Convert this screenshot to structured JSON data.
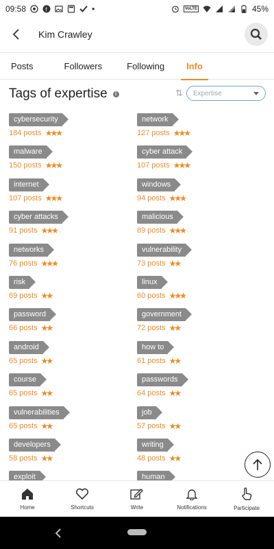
{
  "status_bar": {
    "time": "09:58",
    "dot": "•",
    "battery": "45%",
    "volte": "VoLTE"
  },
  "app_bar": {
    "title": "Kim Crawley"
  },
  "tabs": [
    {
      "label": "Posts"
    },
    {
      "label": "Followers"
    },
    {
      "label": "Following"
    },
    {
      "label": "Info",
      "active": true
    }
  ],
  "section": {
    "title": "Tags of expertise",
    "info": "i",
    "sort_glyph": "⇅",
    "select_value": "Expertise"
  },
  "tags_left": [
    {
      "name": "cybersecurity",
      "posts": "184 posts",
      "stars": "★★★"
    },
    {
      "name": "malware",
      "posts": "150 posts",
      "stars": "★★★"
    },
    {
      "name": "internet",
      "posts": "107 posts",
      "stars": "★★★"
    },
    {
      "name": "cyber attacks",
      "posts": "91 posts",
      "stars": "★★★"
    },
    {
      "name": "networks",
      "posts": "76 posts",
      "stars": "★★★"
    },
    {
      "name": "risk",
      "posts": "69 posts",
      "stars": "★★"
    },
    {
      "name": "password",
      "posts": "66 posts",
      "stars": "★★"
    },
    {
      "name": "android",
      "posts": "65 posts",
      "stars": "★★"
    },
    {
      "name": "course",
      "posts": "65 posts",
      "stars": "★★"
    },
    {
      "name": "vulnerabilities",
      "posts": "65 posts",
      "stars": "★★"
    },
    {
      "name": "developers",
      "posts": "58 posts",
      "stars": "★★"
    },
    {
      "name": "exploit",
      "posts": "",
      "stars": ""
    }
  ],
  "tags_right": [
    {
      "name": "network",
      "posts": "127 posts",
      "stars": "★★★"
    },
    {
      "name": "cyber attack",
      "posts": "107 posts",
      "stars": "★★★"
    },
    {
      "name": "windows",
      "posts": "94 posts",
      "stars": "★★★"
    },
    {
      "name": "malicious",
      "posts": "89 posts",
      "stars": "★★★"
    },
    {
      "name": "vulnerability",
      "posts": "73 posts",
      "stars": "★★"
    },
    {
      "name": "linux",
      "posts": "60 posts",
      "stars": "★★★"
    },
    {
      "name": "government",
      "posts": "72 posts",
      "stars": "★★"
    },
    {
      "name": "how to",
      "posts": "61 posts",
      "stars": "★★"
    },
    {
      "name": "passwords",
      "posts": "64 posts",
      "stars": "★★"
    },
    {
      "name": "job",
      "posts": "57 posts",
      "stars": "★★"
    },
    {
      "name": "writing",
      "posts": "48 posts",
      "stars": "★★"
    },
    {
      "name": "human",
      "posts": "",
      "stars": ""
    }
  ],
  "bottom_nav": [
    {
      "label": "Home",
      "icon": "home-icon"
    },
    {
      "label": "Shortcuts",
      "icon": "heart-icon"
    },
    {
      "label": "Write",
      "icon": "pencil-icon"
    },
    {
      "label": "Notifications",
      "icon": "bell-icon"
    },
    {
      "label": "Participate",
      "icon": "hand-pointer-icon"
    }
  ],
  "colors": {
    "accent": "#f08a24",
    "tag_bg": "#8a8a8a",
    "select_border": "#67a6d8"
  }
}
